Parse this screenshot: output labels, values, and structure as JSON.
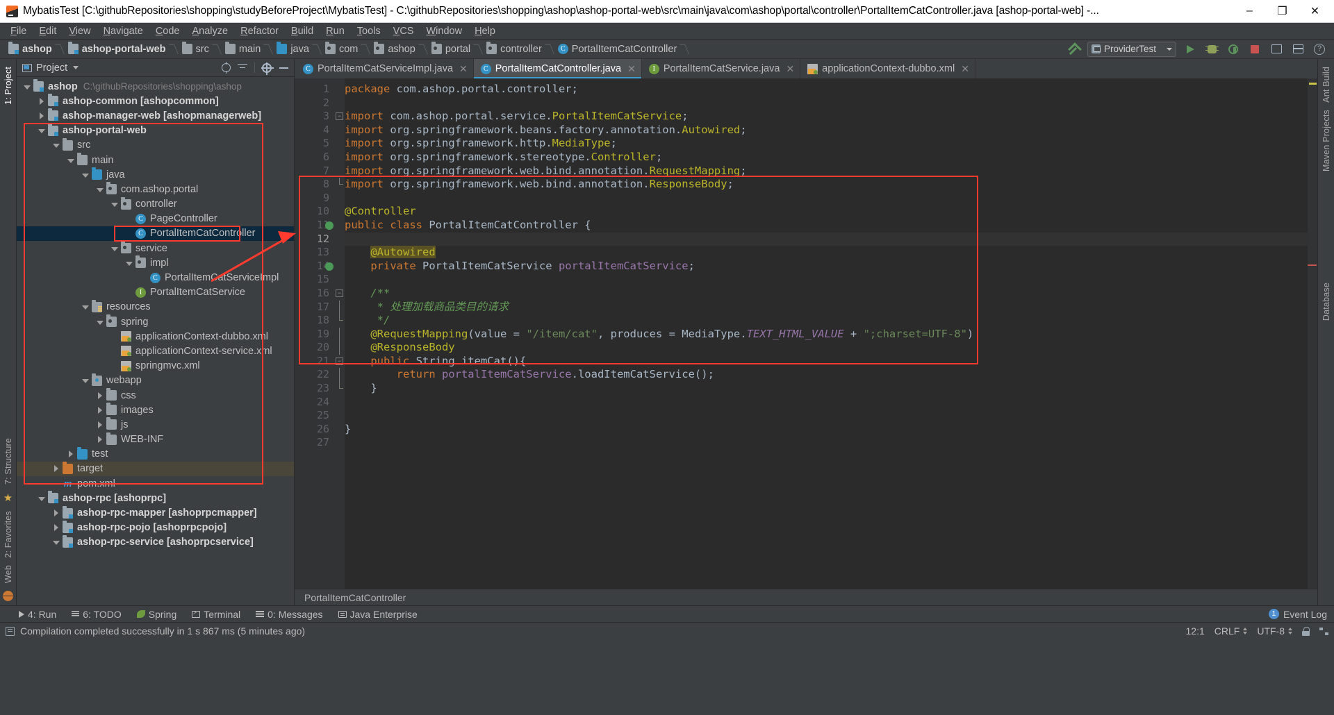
{
  "window": {
    "title": "MybatisTest [C:\\githubRepositories\\shopping\\studyBeforeProject\\MybatisTest] - C:\\githubRepositories\\shopping\\ashop\\ashop-portal-web\\src\\main\\java\\com\\ashop\\portal\\controller\\PortalItemCatController.java [ashop-portal-web] -...",
    "minimize": "–",
    "maximize": "❐",
    "close": "✕"
  },
  "menu": [
    "File",
    "Edit",
    "View",
    "Navigate",
    "Code",
    "Analyze",
    "Refactor",
    "Build",
    "Run",
    "Tools",
    "VCS",
    "Window",
    "Help"
  ],
  "breadcrumb": [
    {
      "label": "ashop",
      "icon": "module-icon",
      "bold": true
    },
    {
      "label": "ashop-portal-web",
      "icon": "module-icon",
      "bold": true
    },
    {
      "label": "src",
      "icon": "folder-icon",
      "bold": false
    },
    {
      "label": "main",
      "icon": "folder-icon",
      "bold": false
    },
    {
      "label": "java",
      "icon": "source-folder-icon",
      "bold": false
    },
    {
      "label": "com",
      "icon": "package-icon",
      "bold": false
    },
    {
      "label": "ashop",
      "icon": "package-icon",
      "bold": false
    },
    {
      "label": "portal",
      "icon": "package-icon",
      "bold": false
    },
    {
      "label": "controller",
      "icon": "package-icon",
      "bold": false
    },
    {
      "label": "PortalItemCatController",
      "icon": "class-icon",
      "bold": false
    }
  ],
  "toolbar": {
    "run_config": "ProviderTest",
    "run_label": "Run",
    "debug_label": "Debug",
    "coverage_label": "Run with Coverage",
    "stop_label": "Stop",
    "layout_label": "Layout",
    "help_label": "?"
  },
  "left_tool_bar": [
    {
      "label": "1: Project",
      "active": true
    },
    {
      "label": "7: Structure",
      "active": false
    },
    {
      "label": "2: Favorites",
      "active": false
    },
    {
      "label": "Web",
      "active": false
    }
  ],
  "right_tool_bar": [
    {
      "label": "Ant Build"
    },
    {
      "label": "Maven Projects"
    },
    {
      "label": "Database"
    }
  ],
  "project_panel": {
    "title": "Project",
    "icons": [
      "target-icon",
      "collapse-all-icon",
      "gear-icon",
      "hide-icon"
    ],
    "tree": [
      {
        "depth": 0,
        "twisty": "down",
        "icon": "module-icon",
        "label": "ashop",
        "bold": true,
        "path": "C:\\githubRepositories\\shopping\\ashop"
      },
      {
        "depth": 1,
        "twisty": "right",
        "icon": "module-icon",
        "label": "ashop-common [ashopcommon]",
        "bold": true
      },
      {
        "depth": 1,
        "twisty": "right",
        "icon": "module-icon",
        "label": "ashop-manager-web [ashopmanagerweb]",
        "bold": true
      },
      {
        "depth": 1,
        "twisty": "down",
        "icon": "module-icon",
        "label": "ashop-portal-web",
        "bold": true
      },
      {
        "depth": 2,
        "twisty": "down",
        "icon": "folder-icon",
        "label": "src",
        "bold": false
      },
      {
        "depth": 3,
        "twisty": "down",
        "icon": "folder-icon",
        "label": "main",
        "bold": false
      },
      {
        "depth": 4,
        "twisty": "down",
        "icon": "source-folder-icon",
        "label": "java",
        "bold": false
      },
      {
        "depth": 5,
        "twisty": "down",
        "icon": "package-icon",
        "label": "com.ashop.portal",
        "bold": false
      },
      {
        "depth": 6,
        "twisty": "down",
        "icon": "package-icon",
        "label": "controller",
        "bold": false
      },
      {
        "depth": 7,
        "twisty": "none",
        "icon": "class-icon",
        "label": "PageController",
        "bold": false
      },
      {
        "depth": 7,
        "twisty": "none",
        "icon": "class-icon",
        "label": "PortalItemCatController",
        "bold": false,
        "selected": true
      },
      {
        "depth": 6,
        "twisty": "down",
        "icon": "package-icon",
        "label": "service",
        "bold": false
      },
      {
        "depth": 7,
        "twisty": "down",
        "icon": "package-icon",
        "label": "impl",
        "bold": false
      },
      {
        "depth": 8,
        "twisty": "none",
        "icon": "class-icon",
        "label": "PortalItemCatServiceImpl",
        "bold": false
      },
      {
        "depth": 7,
        "twisty": "none",
        "icon": "interface-icon",
        "label": "PortalItemCatService",
        "bold": false
      },
      {
        "depth": 4,
        "twisty": "down",
        "icon": "resources-folder-icon",
        "label": "resources",
        "bold": false
      },
      {
        "depth": 5,
        "twisty": "down",
        "icon": "package-icon",
        "label": "spring",
        "bold": false
      },
      {
        "depth": 6,
        "twisty": "none",
        "icon": "xml-spring-icon",
        "label": "applicationContext-dubbo.xml",
        "bold": false
      },
      {
        "depth": 6,
        "twisty": "none",
        "icon": "xml-spring-icon",
        "label": "applicationContext-service.xml",
        "bold": false
      },
      {
        "depth": 6,
        "twisty": "none",
        "icon": "xml-spring-icon",
        "label": "springmvc.xml",
        "bold": false
      },
      {
        "depth": 4,
        "twisty": "down",
        "icon": "web-folder-icon",
        "label": "webapp",
        "bold": false
      },
      {
        "depth": 5,
        "twisty": "right",
        "icon": "folder-icon",
        "label": "css",
        "bold": false
      },
      {
        "depth": 5,
        "twisty": "right",
        "icon": "folder-icon",
        "label": "images",
        "bold": false
      },
      {
        "depth": 5,
        "twisty": "right",
        "icon": "folder-icon",
        "label": "js",
        "bold": false
      },
      {
        "depth": 5,
        "twisty": "right",
        "icon": "folder-icon",
        "label": "WEB-INF",
        "bold": false
      },
      {
        "depth": 3,
        "twisty": "right",
        "icon": "test-folder-icon",
        "label": "test",
        "bold": false
      },
      {
        "depth": 2,
        "twisty": "right",
        "icon": "target-folder-icon",
        "label": "target",
        "bold": false,
        "excluded": true
      },
      {
        "depth": 2,
        "twisty": "none",
        "icon": "maven-icon",
        "label": "pom.xml",
        "bold": false
      },
      {
        "depth": 1,
        "twisty": "down",
        "icon": "module-icon",
        "label": "ashop-rpc [ashoprpc]",
        "bold": true
      },
      {
        "depth": 2,
        "twisty": "right",
        "icon": "module-icon",
        "label": "ashop-rpc-mapper [ashoprpcmapper]",
        "bold": true
      },
      {
        "depth": 2,
        "twisty": "right",
        "icon": "module-icon",
        "label": "ashop-rpc-pojo [ashoprpcpojo]",
        "bold": true
      },
      {
        "depth": 2,
        "twisty": "down",
        "icon": "module-icon",
        "label": "ashop-rpc-service [ashoprpcservice]",
        "bold": true
      }
    ]
  },
  "editor": {
    "tabs": [
      {
        "label": "PortalItemCatServiceImpl.java",
        "icon": "class-icon",
        "active": false,
        "close": "✕"
      },
      {
        "label": "PortalItemCatController.java",
        "icon": "class-icon",
        "active": true,
        "close": "✕"
      },
      {
        "label": "PortalItemCatService.java",
        "icon": "interface-icon",
        "active": false,
        "close": "✕"
      },
      {
        "label": "applicationContext-dubbo.xml",
        "icon": "xml-spring-icon",
        "active": false,
        "close": "✕"
      }
    ],
    "line_numbers": [
      1,
      2,
      3,
      4,
      5,
      6,
      7,
      8,
      9,
      10,
      11,
      12,
      13,
      14,
      15,
      16,
      17,
      18,
      19,
      20,
      21,
      22,
      23,
      24,
      25,
      26,
      27
    ],
    "current_line": 12,
    "breadcrumb": "PortalItemCatController",
    "code_lines": [
      {
        "n": 1,
        "tokens": [
          {
            "t": "package ",
            "c": "kw"
          },
          {
            "t": "com.ashop.portal.controller;",
            "c": "typ"
          }
        ]
      },
      {
        "n": 2,
        "tokens": []
      },
      {
        "n": 3,
        "tokens": [
          {
            "t": "import ",
            "c": "kw"
          },
          {
            "t": "com.ashop.portal.service.",
            "c": "typ"
          },
          {
            "t": "PortalItemCatService",
            "c": "ann"
          },
          {
            "t": ";",
            "c": "typ"
          }
        ]
      },
      {
        "n": 4,
        "tokens": [
          {
            "t": "import ",
            "c": "kw"
          },
          {
            "t": "org.springframework.beans.factory.annotation.",
            "c": "typ"
          },
          {
            "t": "Autowired",
            "c": "ann"
          },
          {
            "t": ";",
            "c": "typ"
          }
        ]
      },
      {
        "n": 5,
        "tokens": [
          {
            "t": "import ",
            "c": "kw"
          },
          {
            "t": "org.springframework.http.",
            "c": "typ"
          },
          {
            "t": "MediaType",
            "c": "ann"
          },
          {
            "t": ";",
            "c": "typ"
          }
        ]
      },
      {
        "n": 6,
        "tokens": [
          {
            "t": "import ",
            "c": "kw"
          },
          {
            "t": "org.springframework.stereotype.",
            "c": "typ"
          },
          {
            "t": "Controller",
            "c": "ann"
          },
          {
            "t": ";",
            "c": "typ"
          }
        ]
      },
      {
        "n": 7,
        "tokens": [
          {
            "t": "import ",
            "c": "kw"
          },
          {
            "t": "org.springframework.web.bind.annotation.",
            "c": "typ"
          },
          {
            "t": "RequestMapping",
            "c": "ann"
          },
          {
            "t": ";",
            "c": "typ"
          }
        ]
      },
      {
        "n": 8,
        "tokens": [
          {
            "t": "import ",
            "c": "kw"
          },
          {
            "t": "org.springframework.web.bind.annotation.",
            "c": "typ"
          },
          {
            "t": "ResponseBody",
            "c": "ann"
          },
          {
            "t": ";",
            "c": "typ"
          }
        ]
      },
      {
        "n": 9,
        "tokens": []
      },
      {
        "n": 10,
        "tokens": [
          {
            "t": "@Controller",
            "c": "ann"
          }
        ]
      },
      {
        "n": 11,
        "tokens": [
          {
            "t": "public class ",
            "c": "kw"
          },
          {
            "t": "PortalItemCatController",
            "c": "typ"
          },
          {
            "t": " {",
            "c": "typ"
          }
        ]
      },
      {
        "n": 12,
        "tokens": []
      },
      {
        "n": 13,
        "tokens": [
          {
            "t": "    ",
            "c": "typ"
          },
          {
            "t": "@Autowired",
            "c": "hl-ann"
          }
        ]
      },
      {
        "n": 14,
        "tokens": [
          {
            "t": "    ",
            "c": "typ"
          },
          {
            "t": "private ",
            "c": "kw"
          },
          {
            "t": "PortalItemCatService ",
            "c": "typ"
          },
          {
            "t": "portalItemCatService",
            "c": "fld"
          },
          {
            "t": ";",
            "c": "typ"
          }
        ]
      },
      {
        "n": 15,
        "tokens": []
      },
      {
        "n": 16,
        "tokens": [
          {
            "t": "    /**",
            "c": "cmt-cn"
          }
        ]
      },
      {
        "n": 17,
        "tokens": [
          {
            "t": "     * 处理加载商品类目的请求",
            "c": "cmt-cn"
          }
        ]
      },
      {
        "n": 18,
        "tokens": [
          {
            "t": "     */",
            "c": "cmt-cn"
          }
        ]
      },
      {
        "n": 19,
        "tokens": [
          {
            "t": "    ",
            "c": "typ"
          },
          {
            "t": "@RequestMapping",
            "c": "ann"
          },
          {
            "t": "(value = ",
            "c": "typ"
          },
          {
            "t": "\"/item/cat\"",
            "c": "str"
          },
          {
            "t": ", produces = MediaType.",
            "c": "typ"
          },
          {
            "t": "TEXT_HTML_VALUE",
            "c": "cst"
          },
          {
            "t": " + ",
            "c": "typ"
          },
          {
            "t": "\";charset=UTF-8\"",
            "c": "str"
          },
          {
            "t": ")",
            "c": "typ"
          }
        ]
      },
      {
        "n": 20,
        "tokens": [
          {
            "t": "    ",
            "c": "typ"
          },
          {
            "t": "@ResponseBody",
            "c": "ann"
          }
        ]
      },
      {
        "n": 21,
        "tokens": [
          {
            "t": "    ",
            "c": "typ"
          },
          {
            "t": "public ",
            "c": "kw"
          },
          {
            "t": "String ",
            "c": "typ"
          },
          {
            "t": "itemCat",
            "c": "typ"
          },
          {
            "t": "(){",
            "c": "typ"
          }
        ]
      },
      {
        "n": 22,
        "tokens": [
          {
            "t": "        ",
            "c": "typ"
          },
          {
            "t": "return ",
            "c": "kw"
          },
          {
            "t": "portalItemCatService",
            "c": "fld"
          },
          {
            "t": ".loadItemCatService();",
            "c": "typ"
          }
        ]
      },
      {
        "n": 23,
        "tokens": [
          {
            "t": "    }",
            "c": "typ"
          }
        ]
      },
      {
        "n": 24,
        "tokens": []
      },
      {
        "n": 25,
        "tokens": []
      },
      {
        "n": 26,
        "tokens": [
          {
            "t": "}",
            "c": "typ"
          }
        ]
      },
      {
        "n": 27,
        "tokens": []
      }
    ]
  },
  "bottom_bar": {
    "items": [
      {
        "label": "4: Run",
        "icon": "run-icon",
        "key": "4"
      },
      {
        "label": "6: TODO",
        "icon": "todo-icon",
        "key": "6"
      },
      {
        "label": "Spring",
        "icon": "spring-icon",
        "key": ""
      },
      {
        "label": "Terminal",
        "icon": "terminal-icon",
        "key": ""
      },
      {
        "label": "0: Messages",
        "icon": "messages-icon",
        "key": "0"
      },
      {
        "label": "Java Enterprise",
        "icon": "java-enterprise-icon",
        "key": ""
      }
    ],
    "event_log": "Event Log",
    "event_count": "1"
  },
  "status_bar": {
    "message": "Compilation completed successfully in 1 s 867 ms (5 minutes ago)",
    "caret": "12:1",
    "line_separator": "CRLF",
    "encoding": "UTF-8"
  },
  "colors": {
    "accent": "#3c9dd0",
    "annotation_red": "#ff3b30",
    "keyword": "#cc7832",
    "annotation_yellow": "#bbb529",
    "string": "#6a8759",
    "comment_cn": "#629755",
    "field": "#9876aa",
    "background": "#2b2b2b",
    "chrome": "#3c3f41"
  }
}
